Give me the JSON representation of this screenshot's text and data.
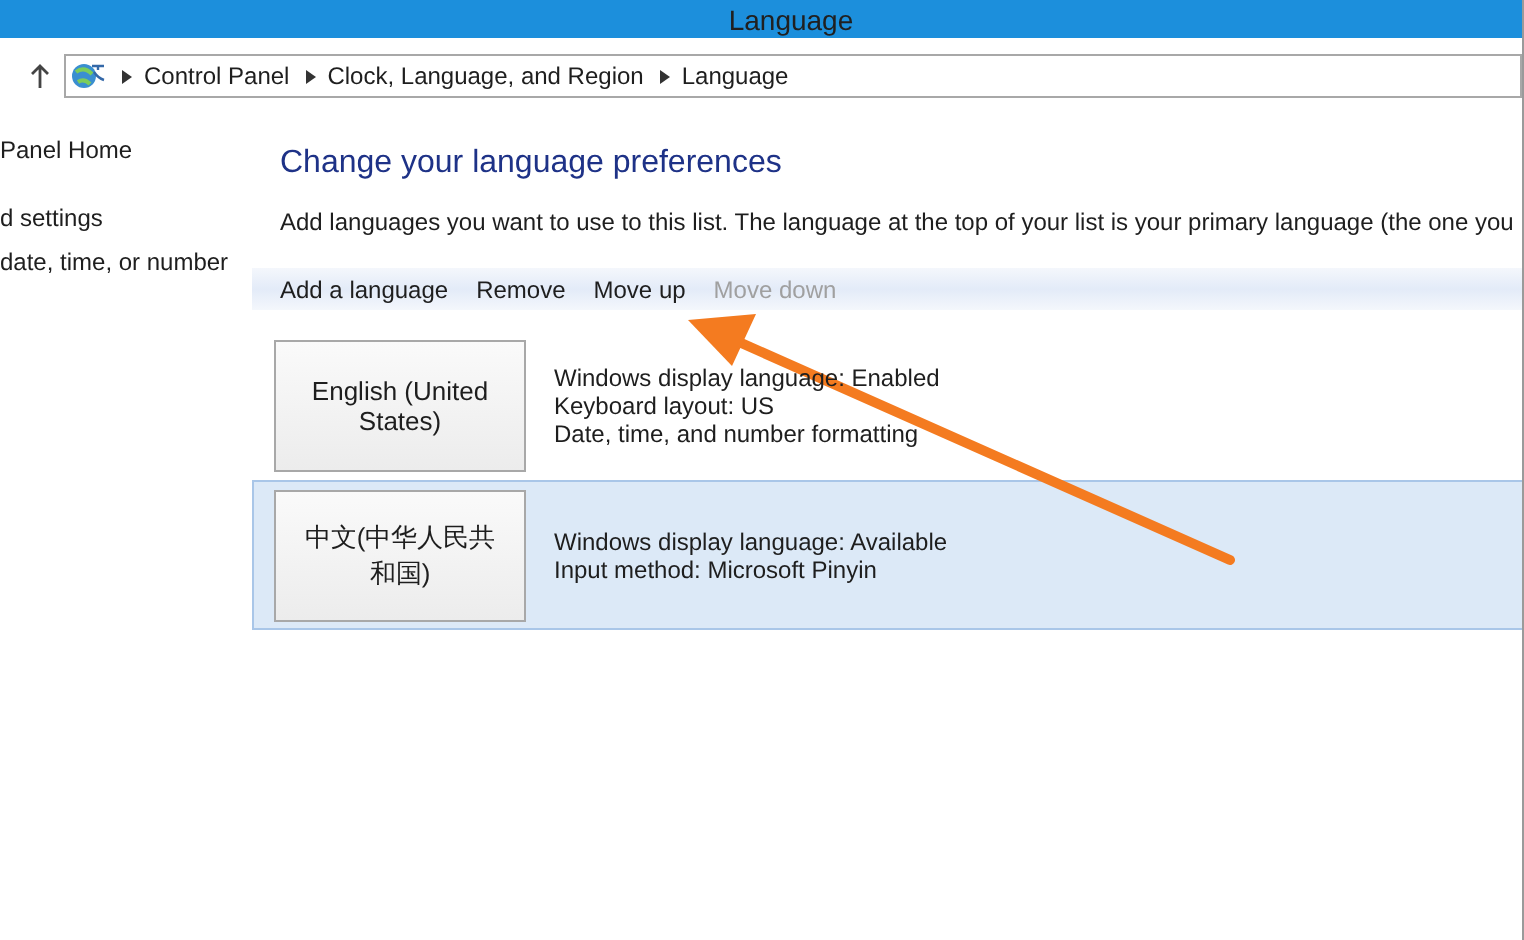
{
  "window": {
    "title": "Language"
  },
  "address_bar": {
    "segments": [
      "Control Panel",
      "Clock, Language, and Region",
      "Language"
    ]
  },
  "sidebar": {
    "items": [
      "Panel Home",
      "d settings",
      "date, time, or number"
    ]
  },
  "heading": "Change your language preferences",
  "description": "Add languages you want to use to this list. The language at the top of your list is your primary language (the one you",
  "toolbar": [
    {
      "label": "Add a language",
      "disabled": false
    },
    {
      "label": "Remove",
      "disabled": false
    },
    {
      "label": "Move up",
      "disabled": false
    },
    {
      "label": "Move down",
      "disabled": true
    }
  ],
  "languages": [
    {
      "name": "English (United States)",
      "selected": false,
      "details": [
        "Windows display language: Enabled",
        "Keyboard layout: US",
        "Date, time, and number formatting"
      ]
    },
    {
      "name": "中文(中华人民共和国)",
      "selected": true,
      "details": [
        "Windows display language: Available",
        "Input method: Microsoft Pinyin"
      ]
    }
  ]
}
